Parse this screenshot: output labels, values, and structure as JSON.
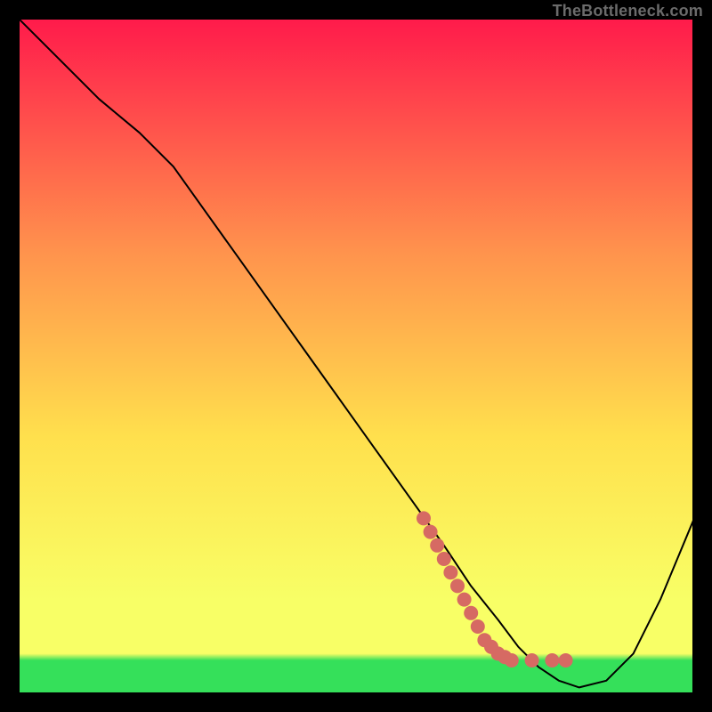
{
  "watermark": "TheBottleneck.com",
  "chart_data": {
    "type": "line",
    "title": "",
    "xlabel": "",
    "ylabel": "",
    "xlim": [
      0,
      100
    ],
    "ylim": [
      0,
      100
    ],
    "grid": false,
    "background_gradient": {
      "top": "#ff1a4b",
      "mid_upper": "#ff944d",
      "mid": "#ffe04d",
      "mid_lower": "#f8ff66",
      "green_band": "#35e05a",
      "bottom": "#35e05a"
    },
    "series": [
      {
        "name": "bottleneck-curve",
        "color": "#000000",
        "stroke_width": 2,
        "x": [
          0,
          6,
          12,
          18,
          23,
          28,
          33,
          38,
          43,
          48,
          53,
          58,
          63,
          67,
          71,
          74,
          77,
          80,
          83,
          87,
          91,
          95,
          100
        ],
        "y": [
          100,
          94,
          88,
          83,
          78,
          71,
          64,
          57,
          50,
          43,
          36,
          29,
          22,
          16,
          11,
          7,
          4,
          2,
          1,
          2,
          6,
          14,
          26
        ]
      }
    ],
    "markers": {
      "name": "highlight-segment",
      "color": "#d66a63",
      "radius": 8,
      "points": [
        {
          "x": 60,
          "y": 26
        },
        {
          "x": 61,
          "y": 24
        },
        {
          "x": 62,
          "y": 22
        },
        {
          "x": 63,
          "y": 20
        },
        {
          "x": 64,
          "y": 18
        },
        {
          "x": 65,
          "y": 16
        },
        {
          "x": 66,
          "y": 14
        },
        {
          "x": 67,
          "y": 12
        },
        {
          "x": 68,
          "y": 10
        },
        {
          "x": 69,
          "y": 8
        },
        {
          "x": 70,
          "y": 7
        },
        {
          "x": 71,
          "y": 6
        },
        {
          "x": 72,
          "y": 5.5
        },
        {
          "x": 73,
          "y": 5
        },
        {
          "x": 76,
          "y": 5
        },
        {
          "x": 79,
          "y": 5
        },
        {
          "x": 81,
          "y": 5
        }
      ]
    }
  }
}
